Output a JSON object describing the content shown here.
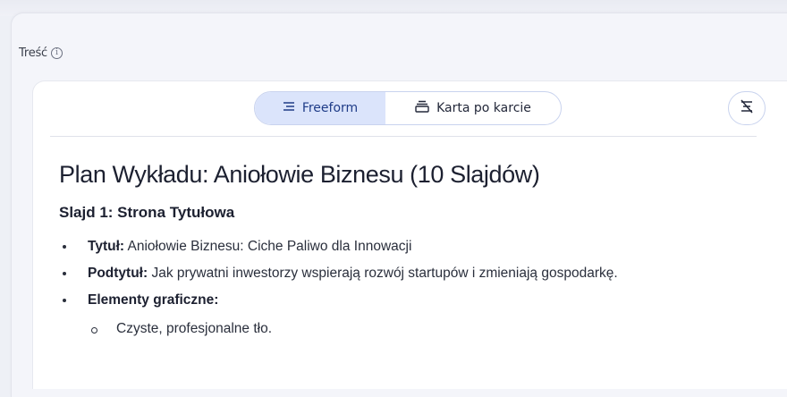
{
  "section": {
    "label": "Treść",
    "info_icon": "info-circle-icon"
  },
  "view_toggle": {
    "freeform": {
      "label": "Freeform",
      "icon": "align-lines-icon",
      "active": true
    },
    "card_by_card": {
      "label": "Karta po karcie",
      "icon": "card-stack-icon",
      "active": false
    }
  },
  "toolbar": {
    "format_icon": "clear-formatting-icon"
  },
  "document": {
    "title": "Plan Wykładu: Aniołowie Biznesu (10 Slajdów)",
    "slide_heading": "Slajd 1: Strona Tytułowa",
    "items": [
      {
        "label": "Tytuł:",
        "text": " Aniołowie Biznesu: Ciche Paliwo dla Innowacji"
      },
      {
        "label": "Podtytuł:",
        "text": " Jak prywatni inwestorzy wspierają rozwój startupów i zmieniają gospodarkę."
      },
      {
        "label": "Elementy graficzne:",
        "text": ""
      }
    ],
    "subitems": [
      "Czyste, profesjonalne tło."
    ]
  },
  "colors": {
    "accent": "#dbe4fb",
    "accent_text": "#1f3c88",
    "border": "#c9d3ee"
  }
}
